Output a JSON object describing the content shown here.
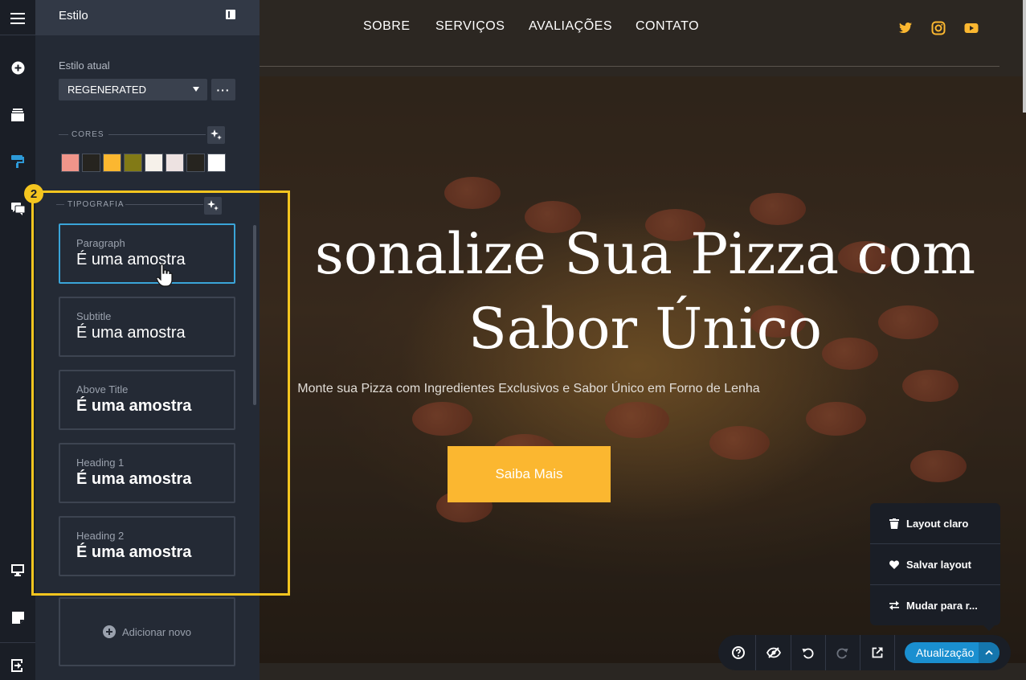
{
  "panel": {
    "title": "Estilo",
    "current_style_label": "Estilo atual",
    "current_style_value": "REGENERATED",
    "more_label": "···",
    "colors_label": "CORES",
    "typography_label": "TIPOGRAFIA",
    "step_badge": "2",
    "swatches": [
      "#f0958a",
      "#26241f",
      "#fbb730",
      "#827a16",
      "#f6f1ea",
      "#ede2e1",
      "#26241f",
      "#ffffff"
    ],
    "typography": [
      {
        "name": "Paragraph",
        "sample": "É uma amostra"
      },
      {
        "name": "Subtitle",
        "sample": "É uma amostra"
      },
      {
        "name": "Above Title",
        "sample": "É uma amostra"
      },
      {
        "name": "Heading 1",
        "sample": "É uma amostra"
      },
      {
        "name": "Heading 2",
        "sample": "É uma amostra"
      }
    ],
    "add_new_label": "Adicionar novo"
  },
  "nav": {
    "links": [
      "SOBRE",
      "SERVIÇOS",
      "AVALIAÇÕES",
      "CONTATO"
    ],
    "social_icons": [
      "twitter-icon",
      "instagram-icon",
      "youtube-icon"
    ],
    "accent": "#fbb730"
  },
  "hero": {
    "title_line1": "sonalize Sua Pizza com",
    "title_line2": "Sabor Único",
    "subtitle": "Monte sua Pizza com Ingredientes Exclusivos e Sabor Único em Forno de Lenha",
    "cta_label": "Saiba Mais",
    "cta_color": "#fbb730"
  },
  "layout_menu": {
    "items": [
      {
        "icon": "trash-icon",
        "label": "Layout claro"
      },
      {
        "icon": "heart-icon",
        "label": "Salvar layout"
      },
      {
        "icon": "swap-icon",
        "label": "Mudar para r..."
      }
    ]
  },
  "toolbar": {
    "update_label": "Atualização",
    "update_color": "#1a8fd0"
  }
}
